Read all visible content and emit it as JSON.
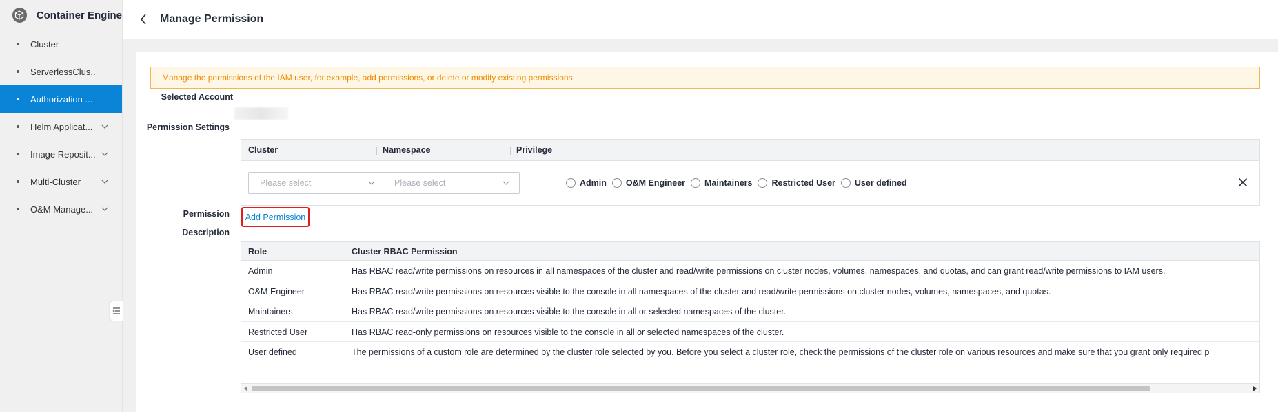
{
  "app": {
    "title": "Container Engine",
    "logo_icon": "cube-icon"
  },
  "sidebar": {
    "items": [
      {
        "label": "Cluster",
        "expandable": false,
        "active": false
      },
      {
        "label": "ServerlessClus...",
        "expandable": false,
        "active": false
      },
      {
        "label": "Authorization ...",
        "expandable": false,
        "active": true
      },
      {
        "label": "Helm Applicat...",
        "expandable": true,
        "active": false
      },
      {
        "label": "Image Reposit...",
        "expandable": true,
        "active": false
      },
      {
        "label": "Multi-Cluster",
        "expandable": true,
        "active": false
      },
      {
        "label": "O&M Manage...",
        "expandable": true,
        "active": false
      }
    ]
  },
  "header": {
    "title": "Manage Permission"
  },
  "alert": {
    "text": "Manage the permissions of the IAM user, for example, add permissions, or delete or modify existing permissions."
  },
  "form": {
    "selected_account_label": "Selected Account",
    "permission_settings_label": "Permission Settings",
    "permission_description_label_1": "Permission",
    "permission_description_label_2": "Description",
    "settings_table": {
      "headers": {
        "cluster": "Cluster",
        "namespace": "Namespace",
        "privilege": "Privilege"
      },
      "cluster_placeholder": "Please select",
      "namespace_placeholder": "Please select",
      "privileges": [
        "Admin",
        "O&M Engineer",
        "Maintainers",
        "Restricted User",
        "User defined"
      ]
    },
    "add_permission_label": "Add Permission",
    "description_table": {
      "headers": {
        "role": "Role",
        "permission": "Cluster RBAC Permission"
      },
      "rows": [
        {
          "role": "Admin",
          "permission": "Has RBAC read/write permissions on resources in all namespaces of the cluster and read/write permissions on cluster nodes, volumes, namespaces, and quotas, and can grant read/write permissions to IAM users."
        },
        {
          "role": "O&M Engineer",
          "permission": "Has RBAC read/write permissions on resources visible to the console in all namespaces of the cluster and read/write permissions on cluster nodes, volumes, namespaces, and quotas."
        },
        {
          "role": "Maintainers",
          "permission": "Has RBAC read/write permissions on resources visible to the console in all or selected namespaces of the cluster."
        },
        {
          "role": "Restricted User",
          "permission": "Has RBAC read-only permissions on resources visible to the console in all or selected namespaces of the cluster."
        },
        {
          "role": "User defined",
          "permission": "The permissions of a custom role are determined by the cluster role selected by you. Before you select a cluster role, check the permissions of the cluster role on various resources and make sure that you grant only required p"
        }
      ]
    }
  },
  "colors": {
    "accent": "#0a84d6",
    "alert_bg": "#fff7e6",
    "alert_border": "#f5b552",
    "alert_text": "#f08c00",
    "highlight_border": "#e01e1e"
  }
}
